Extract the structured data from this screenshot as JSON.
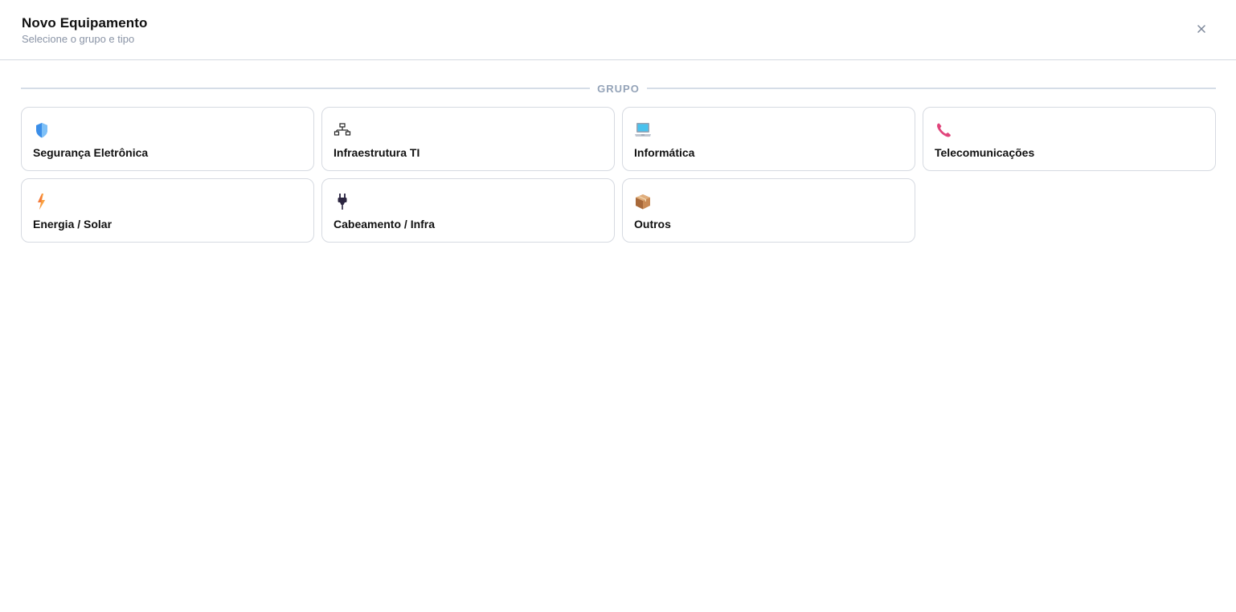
{
  "header": {
    "title": "Novo Equipamento",
    "subtitle": "Selecione o grupo e tipo",
    "close_icon": "close-icon"
  },
  "section": {
    "label": "GRUPO"
  },
  "groups": [
    {
      "label": "Segurança Eletrônica",
      "icon": "shield-icon"
    },
    {
      "label": "Infraestrutura TI",
      "icon": "network-icon"
    },
    {
      "label": "Informática",
      "icon": "laptop-icon"
    },
    {
      "label": "Telecomunicações",
      "icon": "phone-icon"
    },
    {
      "label": "Energia / Solar",
      "icon": "lightning-icon"
    },
    {
      "label": "Cabeamento / Infra",
      "icon": "plug-icon"
    },
    {
      "label": "Outros",
      "icon": "package-icon"
    }
  ],
  "colors": {
    "border": "#d6dae1",
    "muted": "#8a94a6",
    "divider": "#d5dde7"
  }
}
